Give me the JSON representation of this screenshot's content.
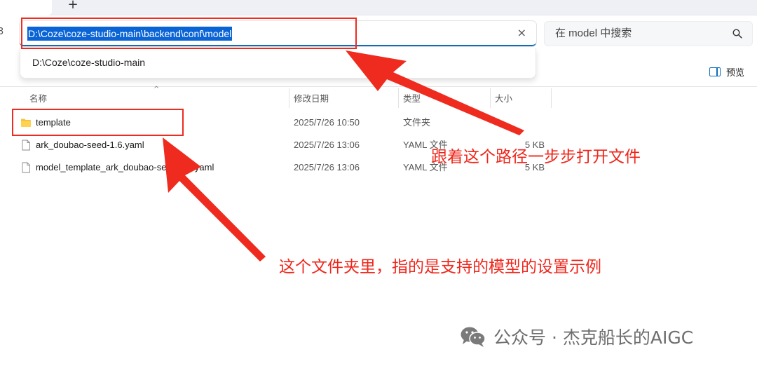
{
  "window": {
    "new_tab_glyph": "+",
    "side_glyph": "3"
  },
  "address_bar": {
    "path": "D:\\Coze\\coze-studio-main\\backend\\conf\\model",
    "clear_glyph": "×",
    "suggestions": [
      "D:\\Coze\\coze-studio-main"
    ]
  },
  "search": {
    "placeholder": "在 model 中搜索",
    "icon": "search-icon"
  },
  "toolbar": {
    "preview_label": "预览",
    "preview_icon": "preview-pane-icon"
  },
  "columns": {
    "name": "名称",
    "modified": "修改日期",
    "type": "类型",
    "size": "大小",
    "sort_glyph": "^"
  },
  "files": [
    {
      "name": "template",
      "modified": "2025/7/26 10:50",
      "type": "文件夹",
      "size": "",
      "icon": "folder-icon"
    },
    {
      "name": "ark_doubao-seed-1.6.yaml",
      "modified": "2025/7/26 13:06",
      "type": "YAML 文件",
      "size": "5 KB",
      "icon": "file-icon"
    },
    {
      "name": "model_template_ark_doubao-seed-1.6.yaml",
      "modified": "2025/7/26 13:06",
      "type": "YAML 文件",
      "size": "5 KB",
      "icon": "file-icon"
    }
  ],
  "annotations": {
    "path_note": "跟着这个路径一步步打开文件",
    "folder_note": "这个文件夹里，指的是支持的模型的设置示例",
    "color": "#ee2b1e"
  },
  "watermark": {
    "text": "公众号 · 杰克船长的AIGC",
    "icon": "wechat-icon"
  },
  "colors": {
    "accent": "#0f6cbd",
    "selection": "#0a64d6",
    "folder": "#f5c242"
  }
}
